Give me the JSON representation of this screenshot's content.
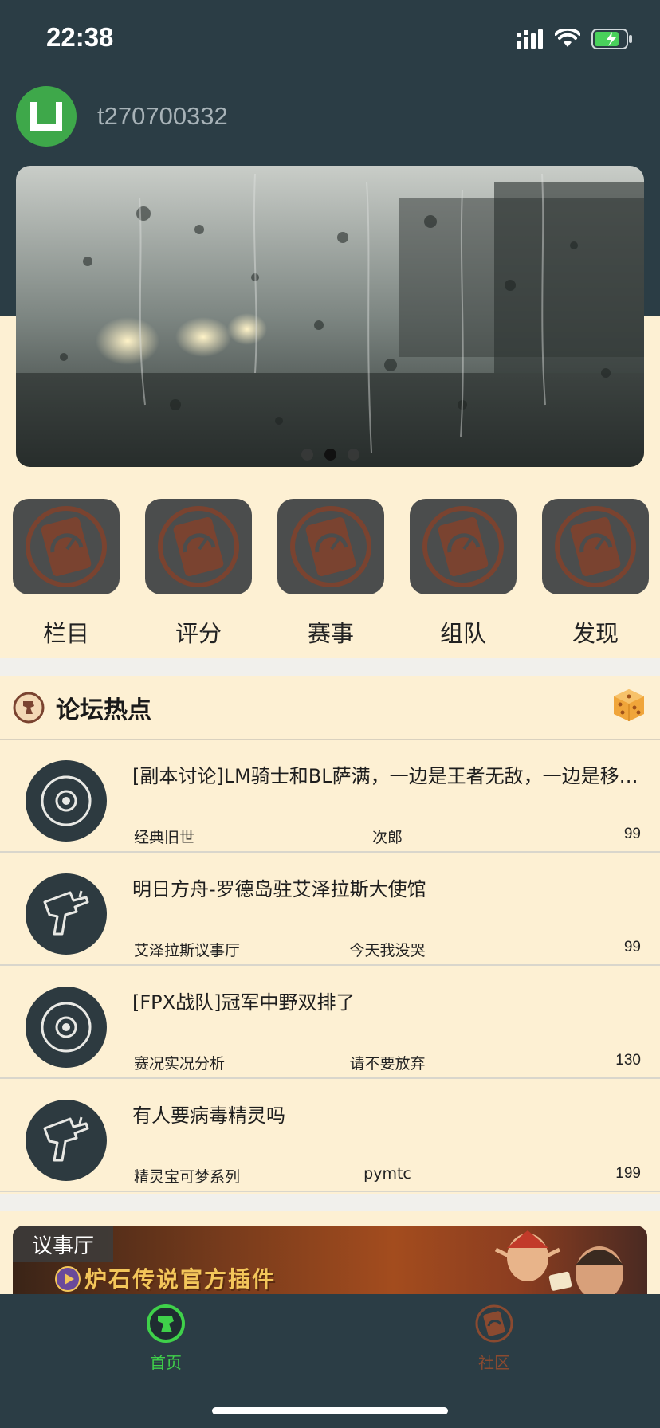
{
  "status": {
    "time": "22:38"
  },
  "user": {
    "name": "t270700332"
  },
  "banner": {
    "page_count": 3,
    "active_index": 1
  },
  "shortcuts": [
    {
      "label": "栏目"
    },
    {
      "label": "评分"
    },
    {
      "label": "赛事"
    },
    {
      "label": "组队"
    },
    {
      "label": "发现"
    }
  ],
  "hot": {
    "title": "论坛热点"
  },
  "posts": [
    {
      "title": "[副本讨论]LM骑士和BL萨满，一边是王者无敌，一边是移动…",
      "forum": "经典旧世",
      "author": "次郎",
      "count": "99",
      "icon": "pokeball-icon"
    },
    {
      "title": "明日方舟-罗德岛驻艾泽拉斯大使馆",
      "forum": "艾泽拉斯议事厅",
      "author": "今天我没哭",
      "count": "99",
      "icon": "water-gun-icon"
    },
    {
      "title": "[FPX战队]冠军中野双排了",
      "forum": "赛况实况分析",
      "author": "请不要放弃",
      "count": "130",
      "icon": "pokeball-icon"
    },
    {
      "title": "有人要病毒精灵吗",
      "forum": "精灵宝可梦系列",
      "author": "pymtc",
      "count": "199",
      "icon": "water-gun-icon"
    }
  ],
  "council": {
    "tag": "议事厅",
    "banner_text": "炉石传说官方插件"
  },
  "tabs": [
    {
      "label": "首页",
      "active": true,
      "color": "#3fd14a"
    },
    {
      "label": "社区",
      "active": false,
      "color": "#8a4a30"
    }
  ]
}
